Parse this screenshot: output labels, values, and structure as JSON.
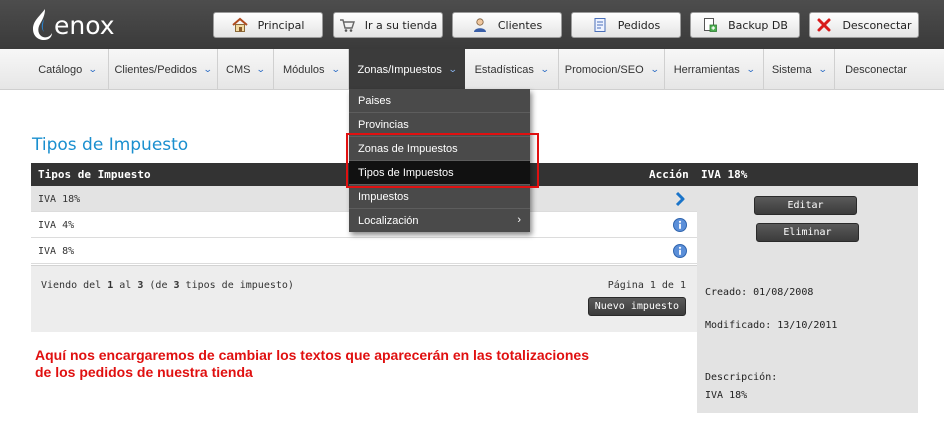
{
  "header": {
    "brand": "enox",
    "buttons": [
      {
        "label": "Principal",
        "icon": "home-icon"
      },
      {
        "label": "Ir a su tienda",
        "icon": "cart-icon"
      },
      {
        "label": "Clientes",
        "icon": "user-icon"
      },
      {
        "label": "Pedidos",
        "icon": "document-icon"
      },
      {
        "label": "Backup DB",
        "icon": "database-icon"
      },
      {
        "label": "Desconectar",
        "icon": "close-icon"
      }
    ]
  },
  "nav": {
    "items": [
      {
        "label": "Catálogo",
        "chevron": true
      },
      {
        "label": "Clientes/Pedidos",
        "chevron": true
      },
      {
        "label": "CMS",
        "chevron": true
      },
      {
        "label": "Módulos",
        "chevron": true
      },
      {
        "label": "Zonas/Impuestos",
        "chevron": true,
        "active": true
      },
      {
        "label": "Estadísticas",
        "chevron": true
      },
      {
        "label": "Promocion/SEO",
        "chevron": true
      },
      {
        "label": "Herramientas",
        "chevron": true
      },
      {
        "label": "Sistema",
        "chevron": true
      },
      {
        "label": "Desconectar",
        "chevron": false
      }
    ],
    "dropdown": [
      {
        "label": "Paises"
      },
      {
        "label": "Provincias"
      },
      {
        "label": "Zonas de Impuestos"
      },
      {
        "label": "Tipos de Impuestos",
        "selected": true
      },
      {
        "label": "Impuestos"
      },
      {
        "label": "Localización",
        "submenu": true
      }
    ]
  },
  "page": {
    "title": "Tipos de Impuesto",
    "table": {
      "headers": {
        "name": "Tipos de Impuesto",
        "action": "Acción"
      },
      "rows": [
        {
          "name": "IVA 18%",
          "action_icon": "chevron-right-icon"
        },
        {
          "name": "IVA 4%",
          "action_icon": "info-icon"
        },
        {
          "name": "IVA 8%",
          "action_icon": "info-icon"
        }
      ]
    },
    "footer": {
      "showing_prefix": "Viendo del ",
      "from": "1",
      "al": " al ",
      "to": "3",
      "de": " (de ",
      "total": "3",
      "suffix": " tipos de impuesto)",
      "page": "Página 1 de 1",
      "new_button": "Nuevo impuesto"
    },
    "side": {
      "heading": "IVA 18%",
      "edit_button": "Editar",
      "delete_button": "Eliminar",
      "created": "Creado: 01/08/2008",
      "modified": "Modificado: 13/10/2011",
      "description_label": "Descripción:",
      "description_value": "IVA 18%"
    },
    "note": "Aquí nos encargaremos de cambiar los textos que aparecerán en las totalizaciones de los pedidos de nuestra tienda"
  },
  "colors": {
    "topbar": "#3f3f3f",
    "accent_title": "#1a8fcf",
    "highlight": "#e01010",
    "dropdown_bg": "#4a4a4a"
  }
}
